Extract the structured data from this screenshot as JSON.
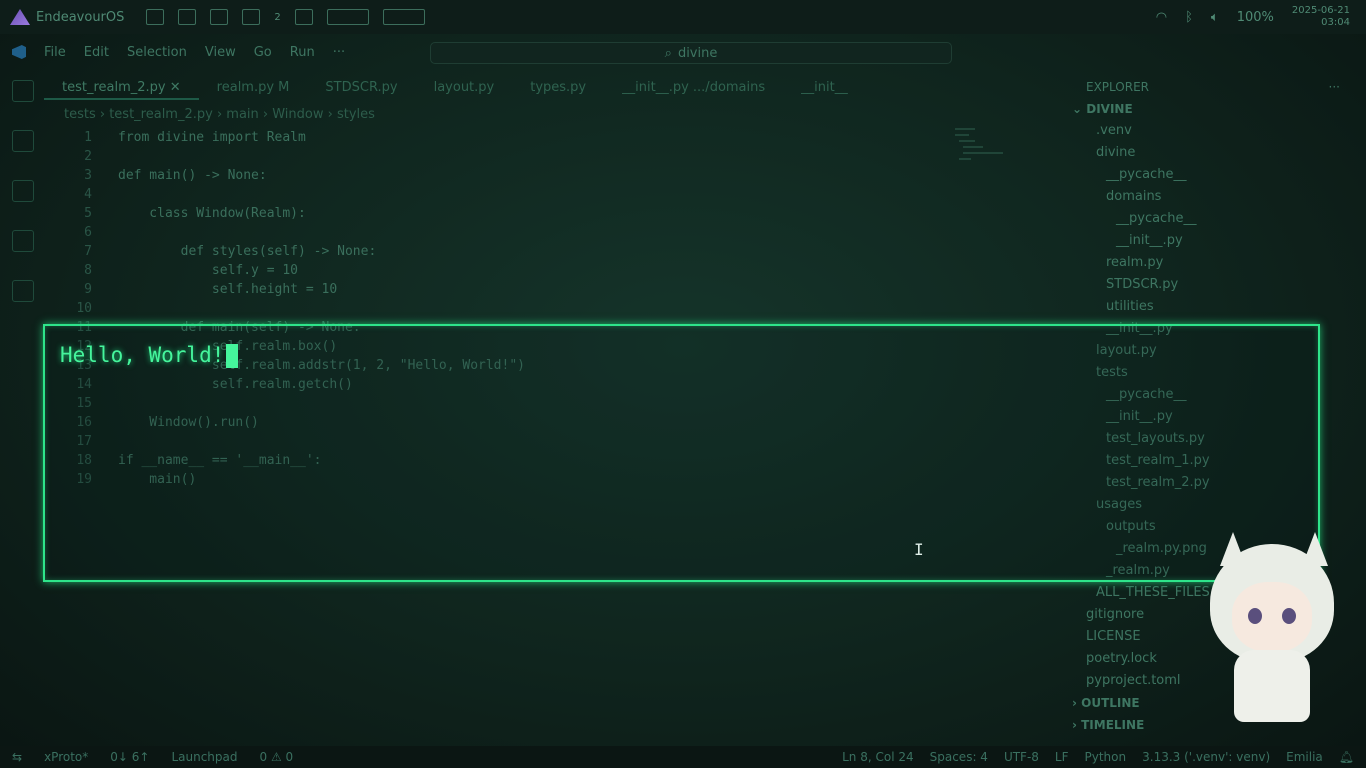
{
  "system": {
    "os_name": "EndeavourOS",
    "notification_badge": "2",
    "battery": "100%",
    "date": "2025-06-21",
    "time": "03:04"
  },
  "menu": {
    "items": [
      "File",
      "Edit",
      "Selection",
      "View",
      "Go",
      "Run",
      "···"
    ],
    "search": "divine"
  },
  "tabs": [
    "test_realm_2.py",
    "realm.py M",
    "STDSCR.py",
    "layout.py",
    "types.py",
    "__init__.py .../domains",
    "__init__"
  ],
  "breadcrumb": "tests › test_realm_2.py › main › Window › styles",
  "code_lines": [
    {
      "n": "1",
      "t": "from divine import Realm"
    },
    {
      "n": "2",
      "t": ""
    },
    {
      "n": "3",
      "t": "def main() -> None:"
    },
    {
      "n": "4",
      "t": ""
    },
    {
      "n": "5",
      "t": "    class Window(Realm):"
    },
    {
      "n": "6",
      "t": ""
    },
    {
      "n": "7",
      "t": "        def styles(self) -> None:"
    },
    {
      "n": "8",
      "t": "            self.y = 10"
    },
    {
      "n": "9",
      "t": "            self.height = 10"
    },
    {
      "n": "10",
      "t": ""
    },
    {
      "n": "11",
      "t": "        def main(self) -> None:"
    },
    {
      "n": "12",
      "t": "            self.realm.box()"
    },
    {
      "n": "13",
      "t": "            self.realm.addstr(1, 2, \"Hello, World!\")"
    },
    {
      "n": "14",
      "t": "            self.realm.getch()"
    },
    {
      "n": "15",
      "t": ""
    },
    {
      "n": "16",
      "t": "    Window().run()"
    },
    {
      "n": "17",
      "t": ""
    },
    {
      "n": "18",
      "t": "if __name__ == '__main__':"
    },
    {
      "n": "19",
      "t": "    main()"
    }
  ],
  "terminal": {
    "text": "Hello, World!"
  },
  "explorer": {
    "title": "EXPLORER",
    "project": "DIVINE",
    "items": [
      ".venv",
      "divine",
      "__pycache__",
      "domains",
      "__pycache__",
      "__init__.py",
      "realm.py",
      "STDSCR.py",
      "utilities",
      "__init__.py",
      "layout.py",
      "tests",
      "__pycache__",
      "__init__.py",
      "test_layouts.py",
      "test_realm_1.py",
      "test_realm_2.py",
      "usages",
      "outputs",
      "_realm.py.png",
      "_realm.py",
      "ALL_THESE_FILES",
      "gitignore",
      "LICENSE",
      "poetry.lock",
      "pyproject.toml"
    ],
    "outline": "OUTLINE",
    "timeline": "TIMELINE"
  },
  "status": {
    "branch": "xProto*",
    "sync": "0↓ 6↑",
    "launchpad": "Launchpad",
    "problems": "0 ⚠ 0",
    "cursor": "Ln 8, Col 24",
    "spaces": "Spaces: 4",
    "encoding": "UTF-8",
    "eol": "LF",
    "language": "Python",
    "interpreter": "3.13.3 ('.venv': venv)",
    "user": "Emilia"
  }
}
